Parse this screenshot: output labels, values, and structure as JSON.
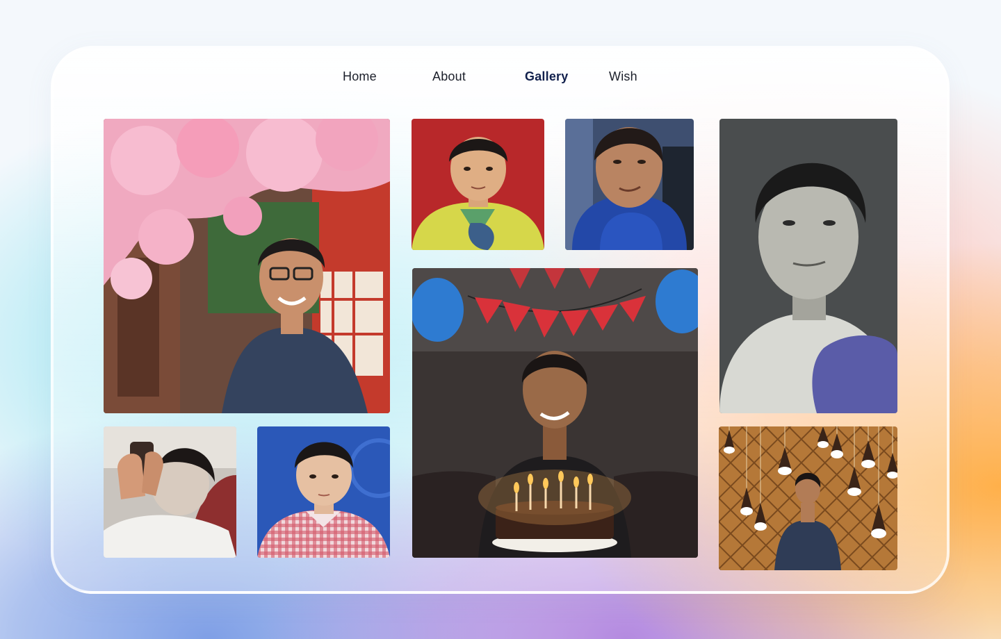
{
  "nav": {
    "items": [
      {
        "label": "Home",
        "active": false
      },
      {
        "label": "About",
        "active": false
      },
      {
        "label": "Gallery",
        "active": true
      },
      {
        "label": "Wish",
        "active": false
      }
    ]
  },
  "gallery": {
    "photos": [
      {
        "name": "photo-cherry-blossom-portrait"
      },
      {
        "name": "photo-school-uniform-child"
      },
      {
        "name": "photo-selfie-gaming-chair"
      },
      {
        "name": "photo-grayscale-id-portrait"
      },
      {
        "name": "photo-birthday-cake"
      },
      {
        "name": "photo-face-mask-phone"
      },
      {
        "name": "photo-red-gingham-child"
      },
      {
        "name": "photo-hanging-lights"
      }
    ]
  },
  "colors": {
    "active_nav": "#12214d",
    "nav_text": "#1b1f2a"
  }
}
